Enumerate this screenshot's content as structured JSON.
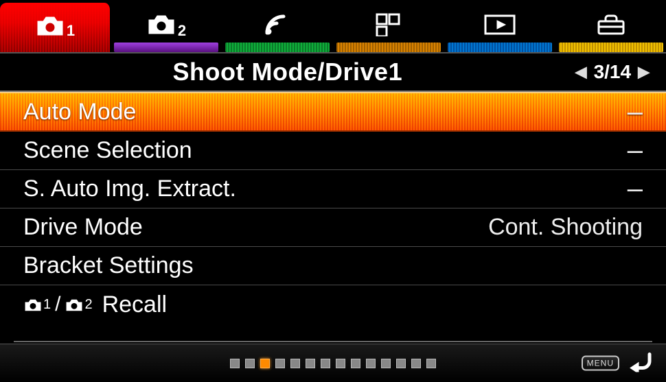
{
  "tabs": [
    {
      "id": "camera1",
      "badge": "1",
      "active": true
    },
    {
      "id": "camera2",
      "badge": "2"
    },
    {
      "id": "wireless"
    },
    {
      "id": "apps"
    },
    {
      "id": "playback"
    },
    {
      "id": "toolbox"
    }
  ],
  "title": "Shoot Mode/Drive1",
  "pager": {
    "current": "3",
    "total": "14",
    "text": "3/14"
  },
  "rows": [
    {
      "label": "Auto Mode",
      "value": "–",
      "selected": true
    },
    {
      "label": "Scene Selection",
      "value": "–"
    },
    {
      "label": "S. Auto Img. Extract.",
      "value": "–"
    },
    {
      "label": "Drive Mode",
      "value": "Cont. Shooting"
    },
    {
      "label": "Bracket Settings",
      "value": ""
    },
    {
      "label": "Recall",
      "value": "",
      "recall": true
    }
  ],
  "recall_badges": {
    "a": "1",
    "b": "2"
  },
  "page_dots": {
    "count": 14,
    "active_index": 2
  },
  "menu_button": "MENU"
}
